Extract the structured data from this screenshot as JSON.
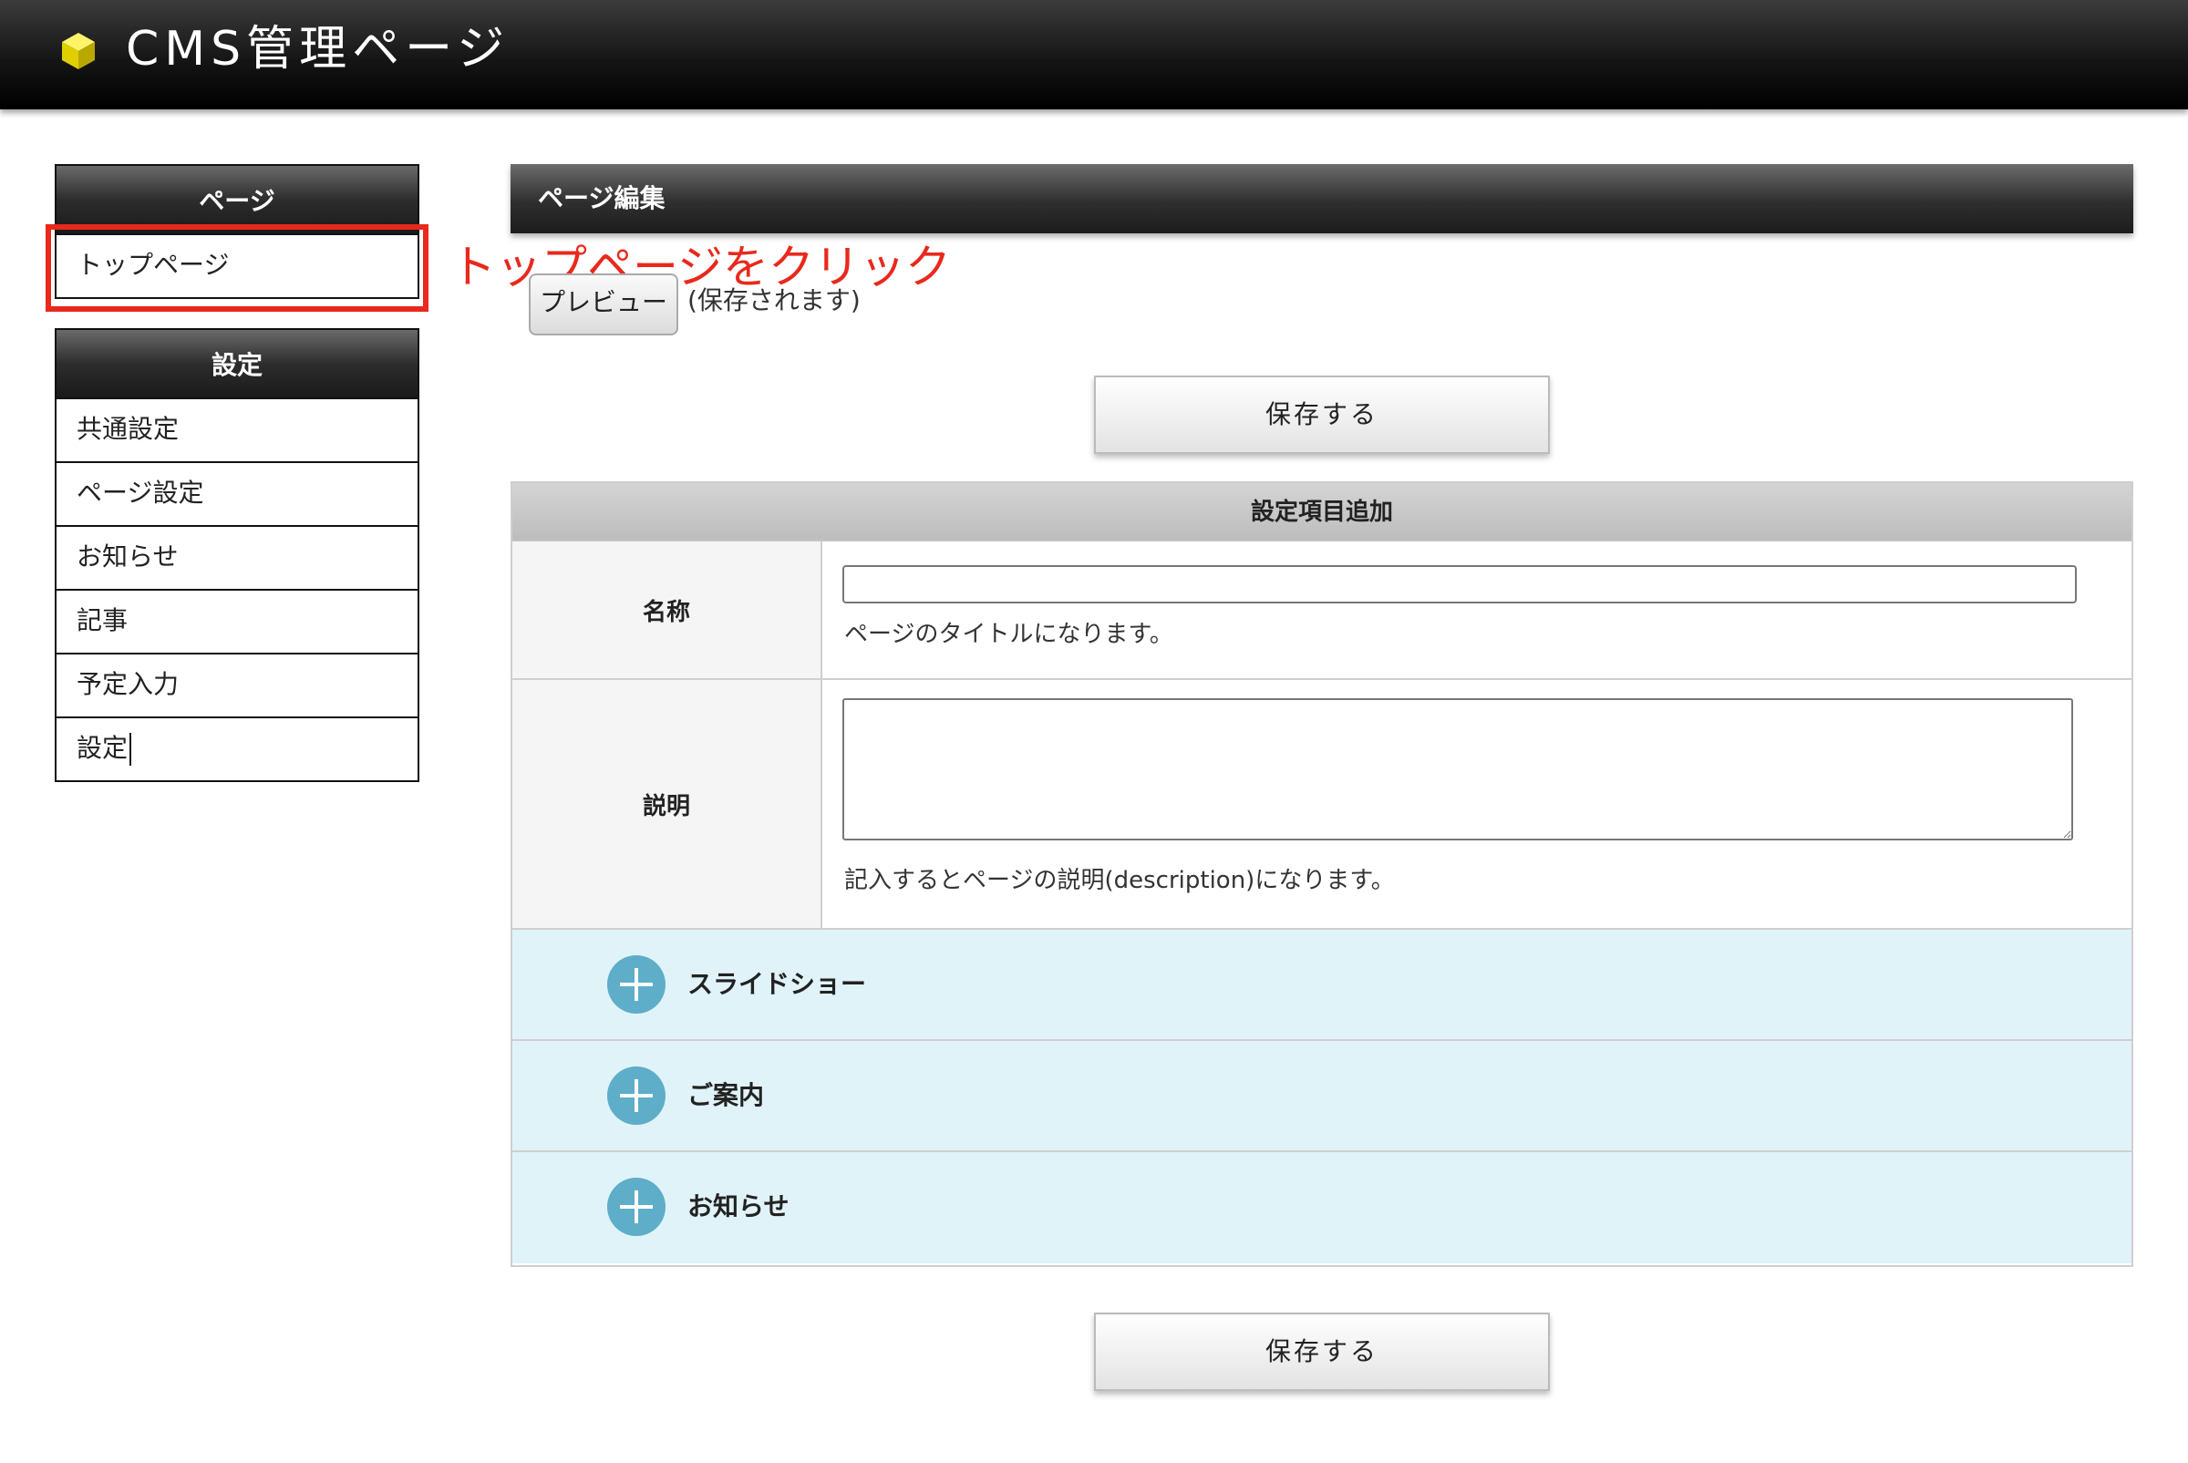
{
  "header": {
    "title": "CMS管理ページ"
  },
  "sidebar": {
    "page_section": {
      "heading": "ページ",
      "items": [
        {
          "label": "トップページ"
        }
      ]
    },
    "settings_section": {
      "heading": "設定",
      "items": [
        {
          "label": "共通設定"
        },
        {
          "label": "ページ設定"
        },
        {
          "label": "お知らせ"
        },
        {
          "label": "記事"
        },
        {
          "label": "予定入力"
        },
        {
          "label": "設定"
        }
      ]
    }
  },
  "annotation": {
    "callout": "トップページをクリック",
    "color": "#e8291c"
  },
  "main": {
    "heading": "ページ編集",
    "preview_button": "プレビュー",
    "preview_note": "(保存されます)",
    "save_button": "保存する",
    "form": {
      "caption": "設定項目追加",
      "name": {
        "label": "名称",
        "value": "",
        "help": "ページのタイトルになります。"
      },
      "description": {
        "label": "説明",
        "value": "",
        "help": "記入するとページの説明(description)になります。"
      },
      "sections": [
        {
          "label": "スライドショー",
          "icon": "plus-circle-icon"
        },
        {
          "label": "ご案内",
          "icon": "plus-circle-icon"
        },
        {
          "label": "お知らせ",
          "icon": "plus-circle-icon"
        }
      ]
    }
  },
  "colors": {
    "accent_plus": "#5eadc9",
    "section_bg": "#e0f3f9",
    "logo": "#e8e000"
  }
}
